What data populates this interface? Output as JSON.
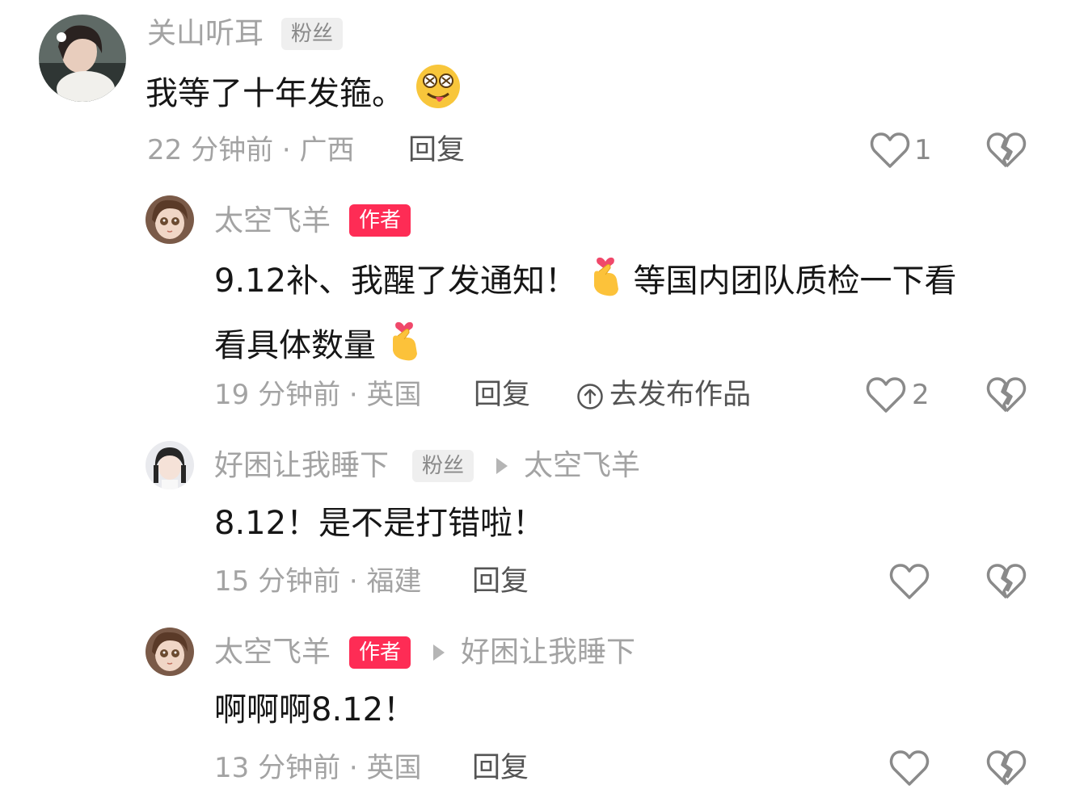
{
  "comments": [
    {
      "username": "关山听耳",
      "badge": "粉丝",
      "text": "我等了十年发箍。",
      "emoji": "smiley-tongue",
      "time": "22 分钟前",
      "location": "广西",
      "reply_label": "回复",
      "like_count": "1"
    },
    {
      "username": "太空飞羊",
      "badge": "作者",
      "text_line1": "9.12补、我醒了发通知！",
      "text_line1b": "等国内团队质检一下看",
      "text_line2": "看具体数量",
      "emoji": "finger-heart",
      "time": "19 分钟前",
      "location": "英国",
      "reply_label": "回复",
      "publish_label": "去发布作品",
      "like_count": "2"
    },
    {
      "username": "好困让我睡下",
      "badge": "粉丝",
      "reply_to": "太空飞羊",
      "text": "8.12！是不是打错啦！",
      "time": "15 分钟前",
      "location": "福建",
      "reply_label": "回复"
    },
    {
      "username": "太空飞羊",
      "badge": "作者",
      "reply_to": "好困让我睡下",
      "text": "啊啊啊8.12！",
      "time": "13 分钟前",
      "location": "英国",
      "reply_label": "回复"
    }
  ],
  "meta_separator": " · ",
  "colors": {
    "author_badge": "#fe2c55",
    "name_gray": "#a3a3a3",
    "text": "#161616"
  }
}
